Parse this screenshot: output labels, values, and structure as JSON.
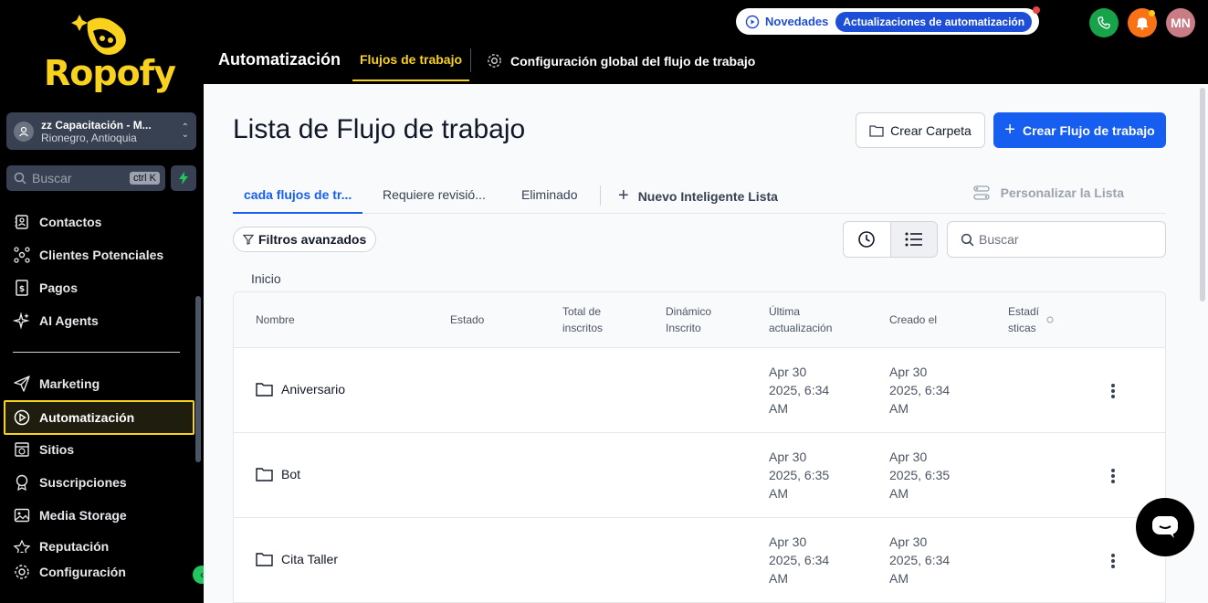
{
  "app": {
    "logo_text": "Ropofy"
  },
  "location": {
    "name": "zz Capacitación - M...",
    "city": "Rionegro, Antioquia"
  },
  "sidebar_search": {
    "placeholder": "Buscar",
    "shortcut": "ctrl K"
  },
  "sidebar": {
    "items": [
      {
        "label": "Contactos",
        "icon": "contacts-icon"
      },
      {
        "label": "Clientes Potenciales",
        "icon": "network-icon"
      },
      {
        "label": "Pagos",
        "icon": "receipt-icon"
      },
      {
        "label": "AI Agents",
        "icon": "sparkle-icon"
      },
      {
        "label": "Marketing",
        "icon": "send-icon"
      },
      {
        "label": "Automatización",
        "icon": "automation-icon",
        "active": true
      },
      {
        "label": "Sitios",
        "icon": "globe-icon"
      },
      {
        "label": "Suscripciones",
        "icon": "badge-icon"
      },
      {
        "label": "Media Storage",
        "icon": "image-icon"
      },
      {
        "label": "Reputación",
        "icon": "star-icon"
      },
      {
        "label": "Configuración",
        "icon": "gear-icon"
      }
    ]
  },
  "header": {
    "title": "Automatización",
    "tab_active": "Flujos de trabajo",
    "global_config": "Configuración global del flujo de trabajo",
    "news_label": "Novedades",
    "news_badge": "Actualizaciones de automatización",
    "avatar_initials": "MN",
    "colors": {
      "accent": "#f8d21c",
      "phone": "#16a34a",
      "bell": "#f97316",
      "avatar": "#c97c84"
    }
  },
  "main": {
    "title": "Lista de Flujo de trabajo",
    "create_folder": "Crear Carpeta",
    "create_workflow": "Crear Flujo de trabajo",
    "tabs": [
      "cada flujos de tr...",
      "Requiere revisió...",
      "Eliminado"
    ],
    "new_smart_list": "Nuevo Inteligente Lista",
    "customize_list": "Personalizar la Lista",
    "advanced_filters": "Filtros avanzados",
    "search_placeholder": "Buscar",
    "breadcrumb": "Inicio",
    "columns": {
      "name": "Nombre",
      "status": "Estado",
      "total_1": "Total de",
      "total_2": "inscritos",
      "dynamic_1": "Dinámico",
      "dynamic_2": "Inscrito",
      "updated_1": "Última",
      "updated_2": "actualización",
      "created": "Creado el",
      "stats_1": "Estadí",
      "stats_2": "sticas"
    },
    "rows": [
      {
        "name": "Aniversario",
        "updated": [
          "Apr 30",
          "2025, 6:34",
          "AM"
        ],
        "created": [
          "Apr 30",
          "2025, 6:34",
          "AM"
        ]
      },
      {
        "name": "Bot",
        "updated": [
          "Apr 30",
          "2025, 6:35",
          "AM"
        ],
        "created": [
          "Apr 30",
          "2025, 6:35",
          "AM"
        ]
      },
      {
        "name": "Cita Taller",
        "updated": [
          "Apr 30",
          "2025, 6:34",
          "AM"
        ],
        "created": [
          "Apr 30",
          "2025, 6:34",
          "AM"
        ]
      }
    ]
  }
}
